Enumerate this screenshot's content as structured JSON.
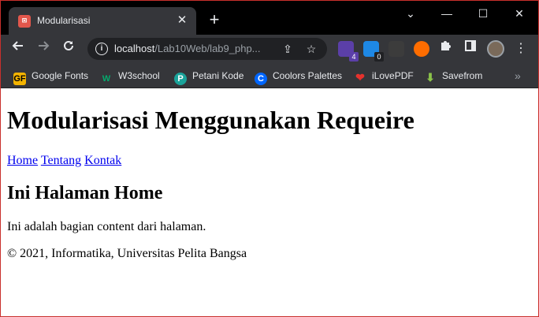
{
  "browser": {
    "tab": {
      "title": "Modularisasi",
      "close_glyph": "✕"
    },
    "new_tab_glyph": "+",
    "window_controls": {
      "chevron": "⌄",
      "minimize": "—",
      "maximize": "☐",
      "close": "✕"
    },
    "address": {
      "host": "localhost",
      "path": "/Lab10Web/lab9_php..."
    },
    "extensions": [
      {
        "name": "extension-1",
        "badge": "4",
        "color": "#5b3fa8"
      },
      {
        "name": "extension-2",
        "badge": "0",
        "color": "#1e88e5"
      },
      {
        "name": "extension-3",
        "badge": "",
        "color": "#3c3c3c"
      },
      {
        "name": "extension-4",
        "badge": "",
        "color": "#ff6d00"
      }
    ],
    "bookmarks": [
      {
        "label": "Google Fonts",
        "icon": "google-fonts-icon",
        "glyph": "GF",
        "color": "#f4b400"
      },
      {
        "label": "W3school",
        "icon": "w3school-icon",
        "glyph": "W",
        "color": "#04aa6d"
      },
      {
        "label": "Petani Kode",
        "icon": "petani-kode-icon",
        "glyph": "P",
        "color": "#1aa39a"
      },
      {
        "label": "Coolors Palettes",
        "icon": "coolors-icon",
        "glyph": "C",
        "color": "#0066ff"
      },
      {
        "label": "iLovePDF",
        "icon": "ilovepdf-icon",
        "glyph": "❤",
        "color": "#e5322d"
      },
      {
        "label": "Savefrom",
        "icon": "savefrom-icon",
        "glyph": "⬇",
        "color": "#8bc34a"
      }
    ],
    "bookmarks_more": "»"
  },
  "page": {
    "heading": "Modularisasi Menggunakan Requeire",
    "nav": [
      "Home",
      "Tentang",
      "Kontak"
    ],
    "subheading": "Ini Halaman Home",
    "content": "Ini adalah bagian content dari halaman.",
    "footer": "© 2021, Informatika, Universitas Pelita Bangsa"
  }
}
